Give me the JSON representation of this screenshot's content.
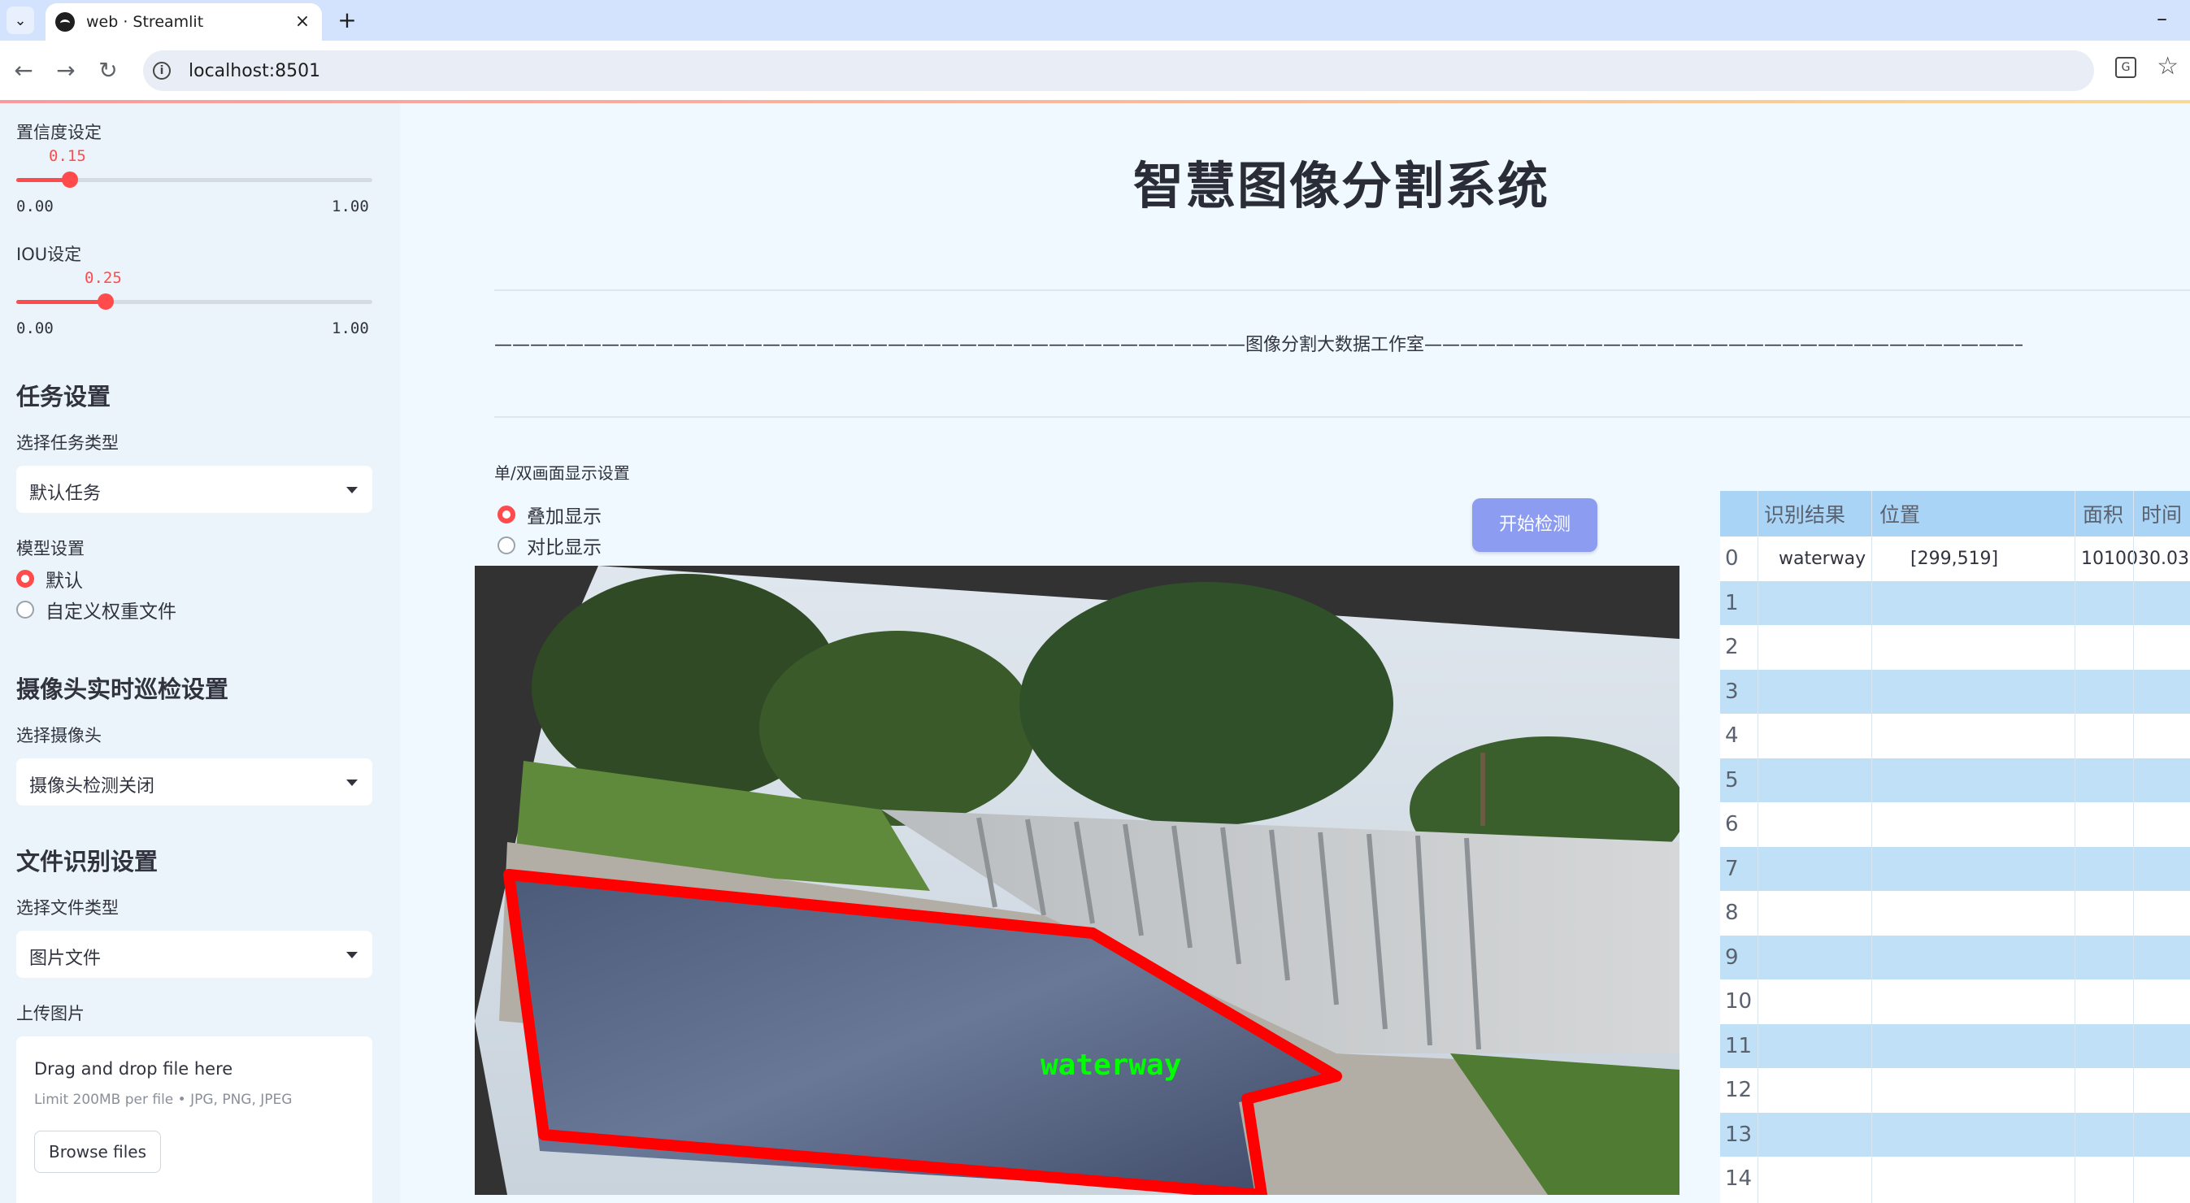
{
  "browser": {
    "tab_title": "web · Streamlit",
    "tab_close": "×",
    "new_tab": "+",
    "minimize": "–",
    "url": "localhost:8501",
    "back": "←",
    "forward": "→",
    "reload": "↻"
  },
  "sidebar": {
    "confidence": {
      "label": "置信度设定",
      "value": "0.15",
      "min": "0.00",
      "max": "1.00",
      "fraction": 0.15
    },
    "iou": {
      "label": "IOU设定",
      "value": "0.25",
      "min": "0.00",
      "max": "1.00",
      "fraction": 0.25
    },
    "task_header": "任务设置",
    "task_type_label": "选择任务类型",
    "task_type_value": "默认任务",
    "model_label": "模型设置",
    "model_options": [
      "默认",
      "自定义权重文件"
    ],
    "model_selected": "默认",
    "camera_header": "摄像头实时巡检设置",
    "camera_label": "选择摄像头",
    "camera_value": "摄像头检测关闭",
    "file_header": "文件识别设置",
    "file_type_label": "选择文件类型",
    "file_type_value": "图片文件",
    "upload_label": "上传图片",
    "upload_title": "Drag and drop file here",
    "upload_limit": "Limit 200MB per file • JPG, PNG, JPEG",
    "browse_label": "Browse files"
  },
  "main": {
    "title": "智慧图像分割系统",
    "divider": "——————————————————————————————————————————图像分割大数据工作室—————————————————————————————————————————————",
    "display_label": "单/双画面显示设置",
    "display_options": [
      "叠加显示",
      "对比显示"
    ],
    "display_selected": "叠加显示",
    "start_button": "开始检测",
    "detection_label": "waterway"
  },
  "table": {
    "columns": [
      "识别结果",
      "位置",
      "面积",
      "时间"
    ],
    "row_indices": [
      "0",
      "1",
      "2",
      "3",
      "4",
      "5",
      "6",
      "7",
      "8",
      "9",
      "10",
      "11",
      "12",
      "13",
      "14"
    ],
    "rows": [
      {
        "result": "waterway",
        "position": "[299,519]",
        "area": "1010030.03"
      }
    ]
  },
  "colors": {
    "accent": "#ff4b4b",
    "button": "#8c9cf0",
    "table_header": "#a9d4f5",
    "table_alt_row": "#bfe0f7",
    "mask_outline": "#ff0000",
    "label_text": "#00ff00"
  }
}
